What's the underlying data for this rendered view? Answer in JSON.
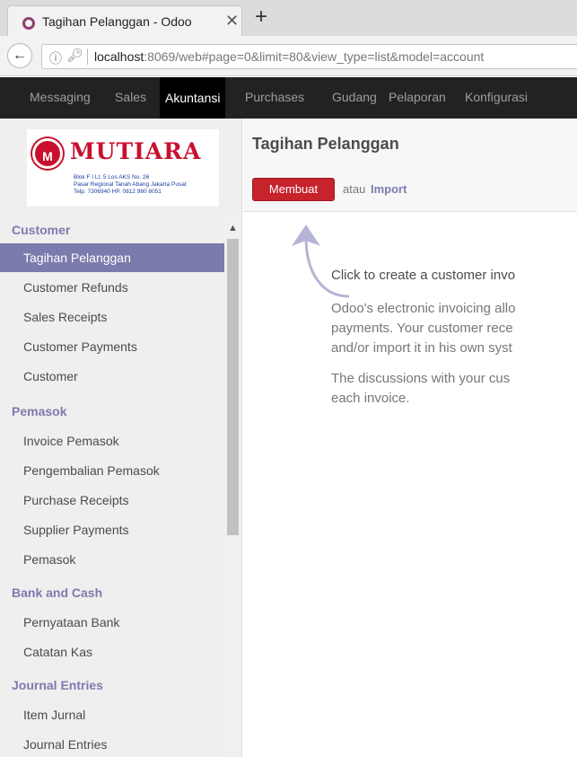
{
  "browser": {
    "tab_title": "Tagihan Pelanggan - Odoo",
    "close_glyph": "✕",
    "newtab_glyph": "+",
    "url_host": "localhost",
    "url_rest": ":8069/web#page=0&limit=80&view_type=list&model=account"
  },
  "topnav": {
    "items": [
      "Messaging",
      "Sales",
      "Akuntansi",
      "Purchases",
      "Gudang",
      "Pelaporan",
      "Konfigurasi"
    ],
    "active": "Akuntansi"
  },
  "logo": {
    "mark": "M",
    "name": "MUTIARA",
    "address": [
      "Blok F I Lt. 5 Los AKS No. 26",
      "Pasar Regional Tanah Abang Jakarta Pusat",
      "Telp. 7306940 HP. 0812 980 8051"
    ]
  },
  "sidebar": {
    "sections": [
      {
        "label": "Customer",
        "items": [
          "Tagihan Pelanggan",
          "Customer Refunds",
          "Sales Receipts",
          "Customer Payments",
          "Customer"
        ]
      },
      {
        "label": "Pemasok",
        "items": [
          "Invoice Pemasok",
          "Pengembalian Pemasok",
          "Purchase Receipts",
          "Supplier Payments",
          "Pemasok"
        ]
      },
      {
        "label": "Bank and Cash",
        "items": [
          "Pernyataan Bank",
          "Catatan Kas"
        ]
      },
      {
        "label": "Journal Entries",
        "items": [
          "Item Jurnal",
          "Journal Entries"
        ]
      }
    ],
    "active_item": "Tagihan Pelanggan"
  },
  "main": {
    "title": "Tagihan Pelanggan",
    "create_label": "Membuat",
    "or_label": "atau",
    "import_label": "Import",
    "help_title": "Click to create a customer invo",
    "help_para1": [
      "Odoo's electronic invoicing allo",
      "payments. Your customer rece",
      "and/or import it in his own syst"
    ],
    "help_para2": [
      "The discussions with your cus",
      "each invoice."
    ]
  },
  "colors": {
    "accent": "#7c7bad",
    "create_button": "#c6232d",
    "topnav_bg": "#222222"
  }
}
